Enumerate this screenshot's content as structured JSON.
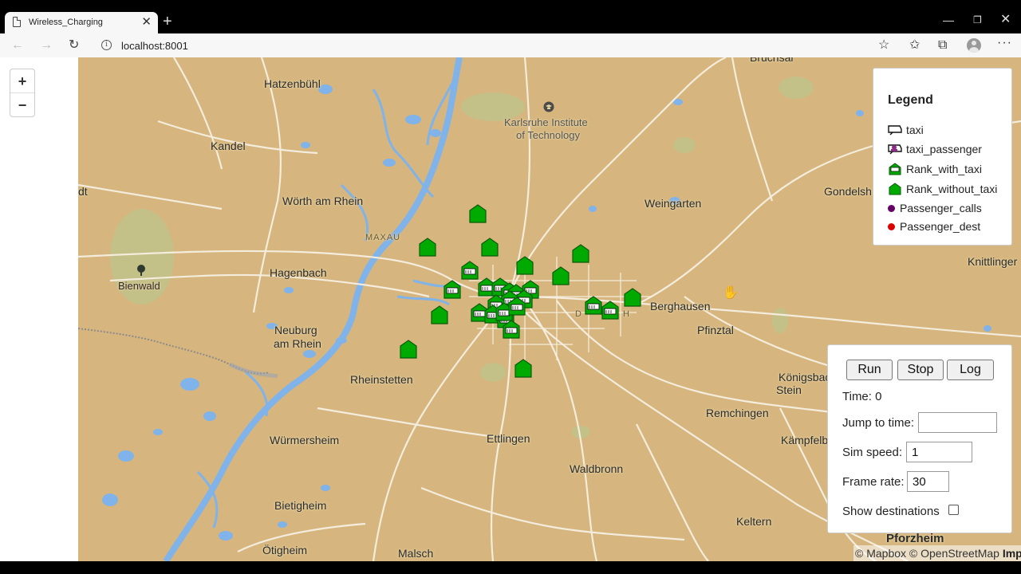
{
  "browser": {
    "tab_title": "Wireless_Charging",
    "tab_close": "✕",
    "new_tab": "+",
    "url": "localhost:8001",
    "window_controls": {
      "minimize": "—",
      "maximize": "❐",
      "close": "✕"
    },
    "nav": {
      "back": "←",
      "forward": "→",
      "reload": "↻"
    },
    "icons": [
      "info-icon",
      "add-favorite-icon",
      "favorites-icon",
      "collections-icon",
      "profile-icon",
      "more-icon"
    ],
    "more": "···"
  },
  "map": {
    "zoom_in": "+",
    "zoom_out": "−",
    "places": {
      "hatzenbuehl": "Hatzenbühl",
      "kandel": "Kandel",
      "woerth": "Wörth am Rhein",
      "maxau": "MAXAU",
      "hagenbach": "Hagenbach",
      "bienwald": "Bienwald",
      "neuburg1": "Neuburg",
      "neuburg2": "am Rhein",
      "rheinstetten": "Rheinstetten",
      "wuermersheim": "Würmersheim",
      "bietigheim": "Bietigheim",
      "oetigheim": "Ötigheim",
      "malsch": "Malsch",
      "ettlingen": "Ettlingen",
      "waldbronn": "Waldbronn",
      "kit1": "Karlsruhe Institute",
      "kit2": "of Technology",
      "weingarten": "Weingarten",
      "gondelsheim": "Gondelsh",
      "knittlingen": "Knittlinger",
      "berghausen": "Berghausen",
      "pfinztal": "Pfinztal",
      "koenigsbach1": "Königsbach-",
      "koenigsbach2": "Stein",
      "remchingen": "Remchingen",
      "kaempfelbach": "Kämpfelb",
      "keltern": "Keltern",
      "pforzheim": "Pforzheim",
      "bruchsal": "Bruchsal",
      "durlach_a": "D",
      "durlach_b": "H",
      "edge_left": "dt"
    },
    "attribution": {
      "mapbox": "© Mapbox",
      "osm": "© OpenStreetMap",
      "improve": "Improve this map"
    },
    "colors": {
      "land": "#d6b67e",
      "water": "#7fb3ea",
      "road": "#f4ecdc",
      "park": "#a9c88a",
      "rank": "#00aa00",
      "passenger_call": "#660066",
      "passenger_dest": "#dd0000"
    }
  },
  "legend": {
    "title": "Legend",
    "items": [
      {
        "label": "taxi",
        "icon": "taxi-icon"
      },
      {
        "label": "taxi_passenger",
        "icon": "taxi-passenger-icon"
      },
      {
        "label": "Rank_with_taxi",
        "icon": "rank-with-taxi-icon"
      },
      {
        "label": "Rank_without_taxi",
        "icon": "rank-without-taxi-icon"
      },
      {
        "label": "Passenger_calls",
        "icon": "passenger-call-dot",
        "color": "#660066"
      },
      {
        "label": "Passenger_dest",
        "icon": "passenger-dest-dot",
        "color": "#dd0000"
      }
    ]
  },
  "controls": {
    "run": "Run",
    "stop": "Stop",
    "log": "Log",
    "time_label": "Time: 0",
    "jump_label": "Jump to time:",
    "jump_value": "",
    "speed_label": "Sim speed:",
    "speed_value": "1",
    "frame_label": "Frame rate:",
    "frame_value": "30",
    "dest_label": "Show destinations",
    "dest_checked": false
  }
}
